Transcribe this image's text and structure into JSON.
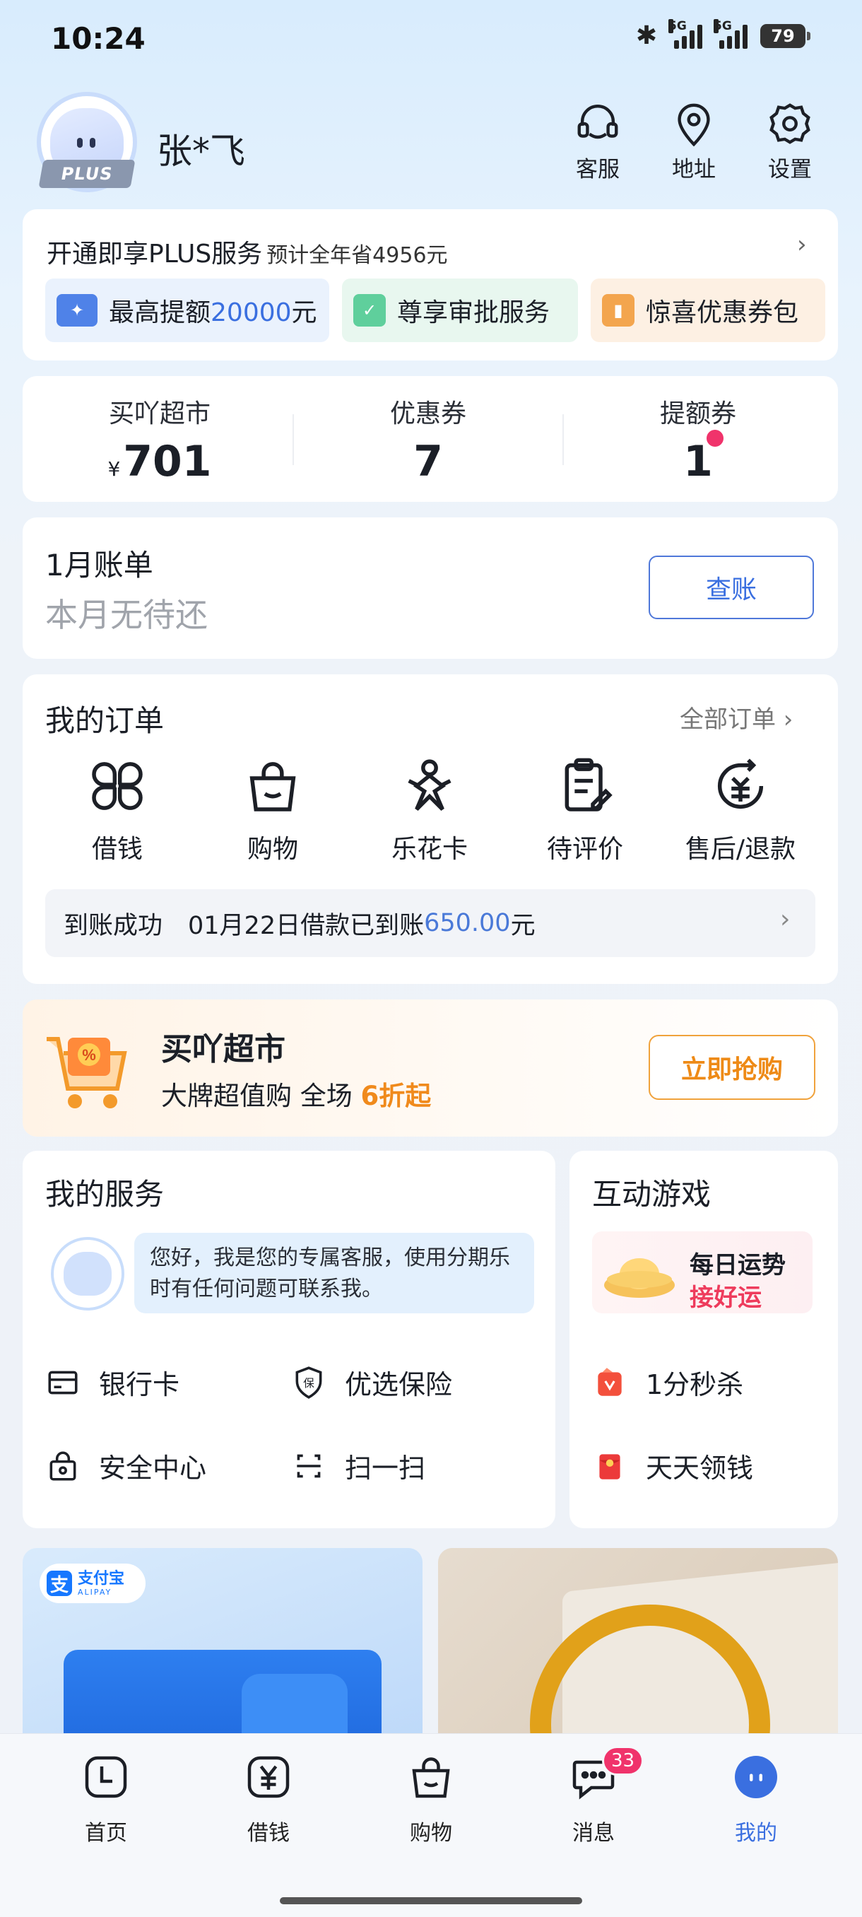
{
  "status_bar": {
    "time": "10:24",
    "net1": "5G",
    "net2": "5G",
    "battery": "79"
  },
  "header": {
    "plus_badge": "PLUS",
    "user_name": "张*飞",
    "actions": [
      {
        "icon": "headset-icon",
        "label": "客服"
      },
      {
        "icon": "location-pin-icon",
        "label": "地址"
      },
      {
        "icon": "gear-icon",
        "label": "设置"
      }
    ]
  },
  "plus_card": {
    "title": "开通即享PLUS服务",
    "note": "预计全年省4956元",
    "chips": [
      {
        "prefix": "最高提额",
        "highlight": "20000",
        "suffix": "元",
        "icon": "credit-limit-icon",
        "color": "#4f82e8",
        "bg": "#eaf2fd"
      },
      {
        "prefix": "尊享审批服务",
        "icon": "approval-icon",
        "color": "#5fcf9c",
        "bg": "#e8f7ef"
      },
      {
        "prefix": "惊喜优惠券包",
        "icon": "coupon-pack-icon",
        "color": "#f3a54e",
        "bg": "#fdf0e3"
      }
    ]
  },
  "stats": [
    {
      "label": "买吖超市",
      "currency": "¥",
      "value": "701"
    },
    {
      "label": "优惠券",
      "value": "7"
    },
    {
      "label": "提额券",
      "value": "1"
    }
  ],
  "bill": {
    "title": "1月账单",
    "subtitle": "本月无待还",
    "button": "查账"
  },
  "orders": {
    "title": "我的订单",
    "all_link": "全部订单",
    "items": [
      {
        "icon": "four-leaf-icon",
        "label": "借钱"
      },
      {
        "icon": "shopping-bag-icon",
        "label": "购物"
      },
      {
        "icon": "flower-card-icon",
        "label": "乐花卡"
      },
      {
        "icon": "clipboard-review-icon",
        "label": "待评价"
      },
      {
        "icon": "refund-icon",
        "label": "售后/退款"
      }
    ],
    "notice": {
      "status": "到账成功",
      "text": "01月22日借款已到账",
      "amount": "650.00",
      "unit": "元"
    }
  },
  "market": {
    "title": "买吖超市",
    "subtitle": "大牌超值购 全场",
    "discount": "6折起",
    "button": "立即抢购",
    "badge": "%"
  },
  "services": {
    "title": "我的服务",
    "greeting": "您好，我是您的专属客服，使用分期乐时有任何问题可联系我。",
    "items": [
      {
        "icon": "bank-card-icon",
        "label": "银行卡"
      },
      {
        "icon": "shield-insurance-icon",
        "label": "优选保险"
      },
      {
        "icon": "lock-security-icon",
        "label": "安全中心"
      },
      {
        "icon": "scan-icon",
        "label": "扫一扫"
      }
    ]
  },
  "games": {
    "title": "互动游戏",
    "fortune_line1": "每日运势",
    "fortune_line2": "接好运",
    "items": [
      {
        "icon": "flash-sale-icon",
        "label": "1分秒杀"
      },
      {
        "icon": "red-envelope-icon",
        "label": "天天领钱"
      }
    ]
  },
  "banners": {
    "alipay_zh": "支付宝",
    "alipay_en": "ALIPAY",
    "alipay_mark": "支"
  },
  "tabbar": {
    "tabs": [
      {
        "icon": "clock-home-icon",
        "label": "首页"
      },
      {
        "icon": "yuan-icon",
        "label": "借钱"
      },
      {
        "icon": "shopping-bag-icon",
        "label": "购物"
      },
      {
        "icon": "chat-bubble-icon",
        "label": "消息"
      },
      {
        "icon": "mine-avatar-icon",
        "label": "我的"
      }
    ],
    "message_badge": "33",
    "active_color": "#3a6fe0"
  }
}
